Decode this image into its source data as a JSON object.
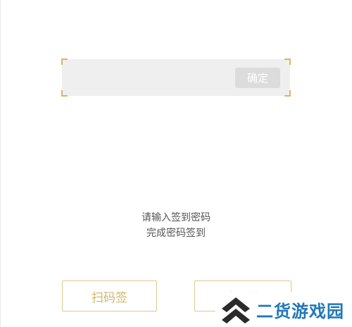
{
  "sign_in": {
    "code_input_value": "",
    "confirm_label": "确定",
    "instruction_line1": "请输入签到密码",
    "instruction_line2": "完成密码签到",
    "scan_label": "扫码签",
    "password_label": "密码签"
  },
  "watermark": {
    "text": "二货游戏园",
    "icon": "double-chevron-up-icon"
  },
  "colors": {
    "accent": "#d2b66a",
    "panel_bg": "#efefef",
    "confirm_bg": "#dcdcdc",
    "watermark_text": "#1f77b8",
    "watermark_icon": "#2b2b2b"
  }
}
